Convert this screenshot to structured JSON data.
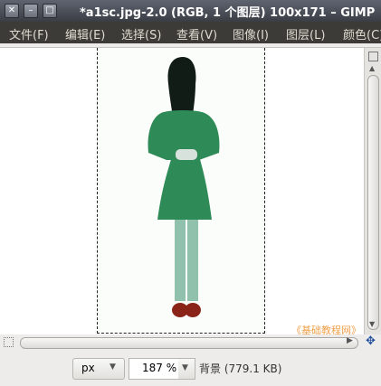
{
  "window": {
    "title": "*a1sc.jpg-2.0 (RGB, 1 个图层) 100x171 – GIMP",
    "buttons": {
      "close": "✕",
      "minimize": "–",
      "maximize": "□"
    }
  },
  "menu": {
    "items": [
      "文件(F)",
      "编辑(E)",
      "选择(S)",
      "查看(V)",
      "图像(I)",
      "图层(L)",
      "颜色(C)"
    ]
  },
  "canvas": {
    "watermark": "《基础教程网》"
  },
  "statusbar": {
    "unit": "px",
    "zoom": "187 %",
    "layer_info": "背景 (779.1 KB)"
  },
  "colors": {
    "dress": "#2e8b57",
    "pants": "#8fc1ad",
    "hair": "#121c17",
    "shoes": "#8b2418"
  }
}
